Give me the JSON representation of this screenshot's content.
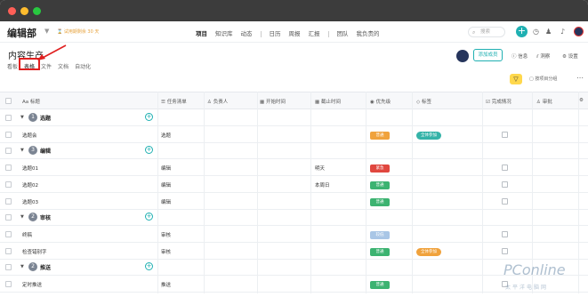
{
  "app": {
    "workspace": "编辑部",
    "trial": "⌛ 试用期剩余 30 天",
    "nav": [
      "项目",
      "知识库",
      "动态",
      "日历",
      "周报",
      "汇报",
      "团队",
      "我负责的"
    ],
    "search_placeholder": "搜索"
  },
  "project": {
    "title": "内容生产",
    "tabs": [
      "看板",
      "表格",
      "文件",
      "文档",
      "自动化"
    ],
    "selected_tab": "表格",
    "add_member_label": "添加成员",
    "actions": [
      "信息",
      "洞察",
      "设置"
    ],
    "filter_label": "按项目分组"
  },
  "table": {
    "columns": [
      "标题",
      "任务清单",
      "负责人",
      "开始时间",
      "截止时间",
      "优先级",
      "标签",
      "完成情况",
      "审批"
    ],
    "rows": [
      {
        "type": "group",
        "num": "1",
        "name": "选题"
      },
      {
        "type": "task",
        "title": "选题会",
        "list": "选题",
        "start": "",
        "due": "",
        "priority": "普通",
        "priority_color": "#f0a23c",
        "tag": "全体参加",
        "tag_color": "#34b3a8"
      },
      {
        "type": "group",
        "num": "3",
        "name": "编辑"
      },
      {
        "type": "task",
        "title": "选题01",
        "list": "编辑",
        "start": "",
        "due": "明天",
        "priority": "紧急",
        "priority_color": "#e0473f",
        "tag": "",
        "tag_color": ""
      },
      {
        "type": "task",
        "title": "选题02",
        "list": "编辑",
        "start": "",
        "due": "本周日",
        "priority": "普通",
        "priority_color": "#3cb371",
        "tag": "",
        "tag_color": ""
      },
      {
        "type": "task",
        "title": "选题03",
        "list": "编辑",
        "start": "",
        "due": "",
        "priority": "普通",
        "priority_color": "#3cb371",
        "tag": "",
        "tag_color": ""
      },
      {
        "type": "group",
        "num": "2",
        "name": "审核"
      },
      {
        "type": "task",
        "title": "终稿",
        "list": "审核",
        "start": "",
        "due": "",
        "priority": "较低",
        "priority_color": "#a9c6e6",
        "tag": "",
        "tag_color": ""
      },
      {
        "type": "task",
        "title": "检查错别字",
        "list": "审核",
        "start": "",
        "due": "",
        "priority": "普通",
        "priority_color": "#3cb371",
        "tag": "全体参加",
        "tag_color": "#f0a23c"
      },
      {
        "type": "group",
        "num": "2",
        "name": "推送"
      },
      {
        "type": "task",
        "title": "定时推送",
        "list": "推送",
        "start": "",
        "due": "",
        "priority": "普通",
        "priority_color": "#3cb371",
        "tag": "",
        "tag_color": ""
      }
    ]
  }
}
